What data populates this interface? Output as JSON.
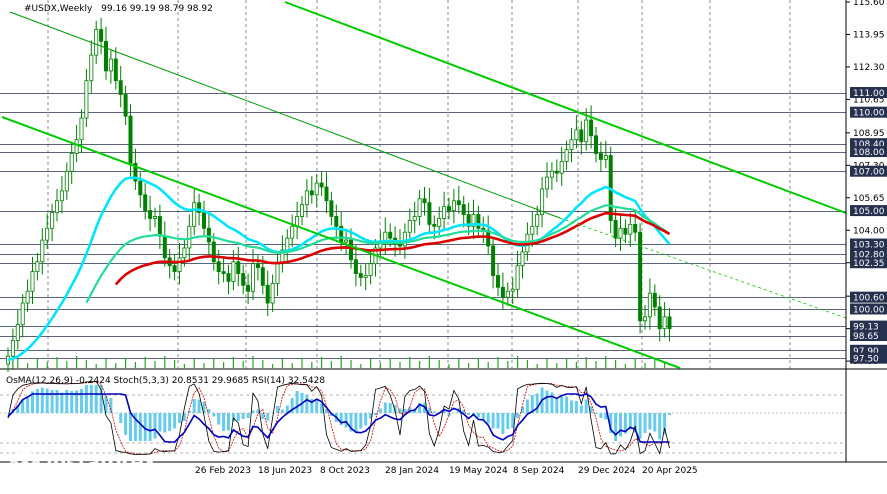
{
  "header": {
    "symbol": "#USDX,Weekly",
    "ohlc": "99.16 99.19 98.79 98.92",
    "indicators": "OsMA(12,26,9) -0.2424  Stoch(5,3,3) 20.8531 29.9685  RSI(14) 32.5428"
  },
  "colors": {
    "background": "#ffffff",
    "candle": "#008000",
    "trend_line": "#00cc00",
    "ema50": "#00e5ff",
    "ema144": "#22dd99",
    "ema200": "#dd0000",
    "osma": "#66ccee",
    "stoch_main": "#000000",
    "stoch_signal": "#cc0000",
    "rsi": "#0000bb",
    "level_line": "#26304f",
    "label_bg": "#26304f"
  },
  "chart_data": {
    "type": "candlestick",
    "title": "#USDX,Weekly",
    "ylim": [
      97.0,
      115.6
    ],
    "x_tick_labels": [
      "26 Feb 2023",
      "18 Jun 2023",
      "8 Oct 2023",
      "28 Jan 2024",
      "19 May 2024",
      "8 Sep 2024",
      "29 Dec 2024",
      "20 Apr 2025"
    ],
    "y_tick_labels": [
      "115.60",
      "113.95",
      "112.30",
      "110.65",
      "108.95",
      "107.30",
      "105.65",
      "104.00",
      "102.35",
      "100.65",
      "99.00",
      "97.35"
    ],
    "level_labels": [
      "111.00",
      "110.00",
      "108.40",
      "108.00",
      "107.00",
      "105.00",
      "103.30",
      "102.80",
      "102.35",
      "100.60",
      "100.00",
      "99.13",
      "98.65",
      "97.90",
      "97.50"
    ],
    "last_close": 98.92,
    "closes": [
      97.6,
      98.4,
      99.2,
      100.3,
      100.9,
      101.9,
      102.4,
      103.5,
      104.1,
      104.9,
      105.5,
      106.0,
      107.0,
      107.9,
      108.6,
      109.7,
      111.6,
      112.9,
      114.2,
      113.6,
      112.1,
      112.7,
      111.6,
      110.9,
      109.8,
      107.4,
      106.5,
      105.8,
      105.0,
      104.6,
      104.7,
      103.7,
      102.6,
      102.2,
      101.9,
      102.6,
      103.1,
      104.2,
      105.4,
      104.9,
      104.1,
      103.4,
      102.4,
      101.9,
      101.8,
      101.4,
      102.4,
      101.8,
      101.2,
      100.9,
      102.3,
      102.1,
      101.2,
      100.3,
      101.3,
      102.3,
      103.0,
      103.6,
      104.2,
      104.7,
      105.3,
      106.0,
      105.8,
      106.4,
      106.2,
      105.5,
      104.7,
      104.2,
      103.4,
      103.5,
      102.5,
      101.8,
      101.6,
      101.7,
      102.3,
      103.1,
      103.4,
      103.9,
      103.6,
      103.3,
      103.2,
      103.9,
      104.5,
      104.7,
      105.6,
      105.4,
      104.3,
      104.2,
      104.6,
      105.2,
      105.0,
      105.5,
      105.3,
      104.8,
      104.2,
      104.8,
      104.1,
      104.0,
      103.2,
      101.7,
      101.1,
      100.6,
      100.9,
      101.0,
      102.2,
      102.9,
      103.8,
      104.2,
      104.8,
      106.1,
      106.7,
      107.0,
      106.9,
      107.5,
      108.1,
      108.6,
      109.1,
      108.5,
      109.6,
      108.8,
      107.9,
      107.6,
      107.8,
      104.5,
      103.6,
      104.1,
      103.8,
      104.3,
      103.9,
      99.4,
      99.6,
      100.8,
      100.1,
      99.0,
      99.6,
      99.0
    ]
  }
}
